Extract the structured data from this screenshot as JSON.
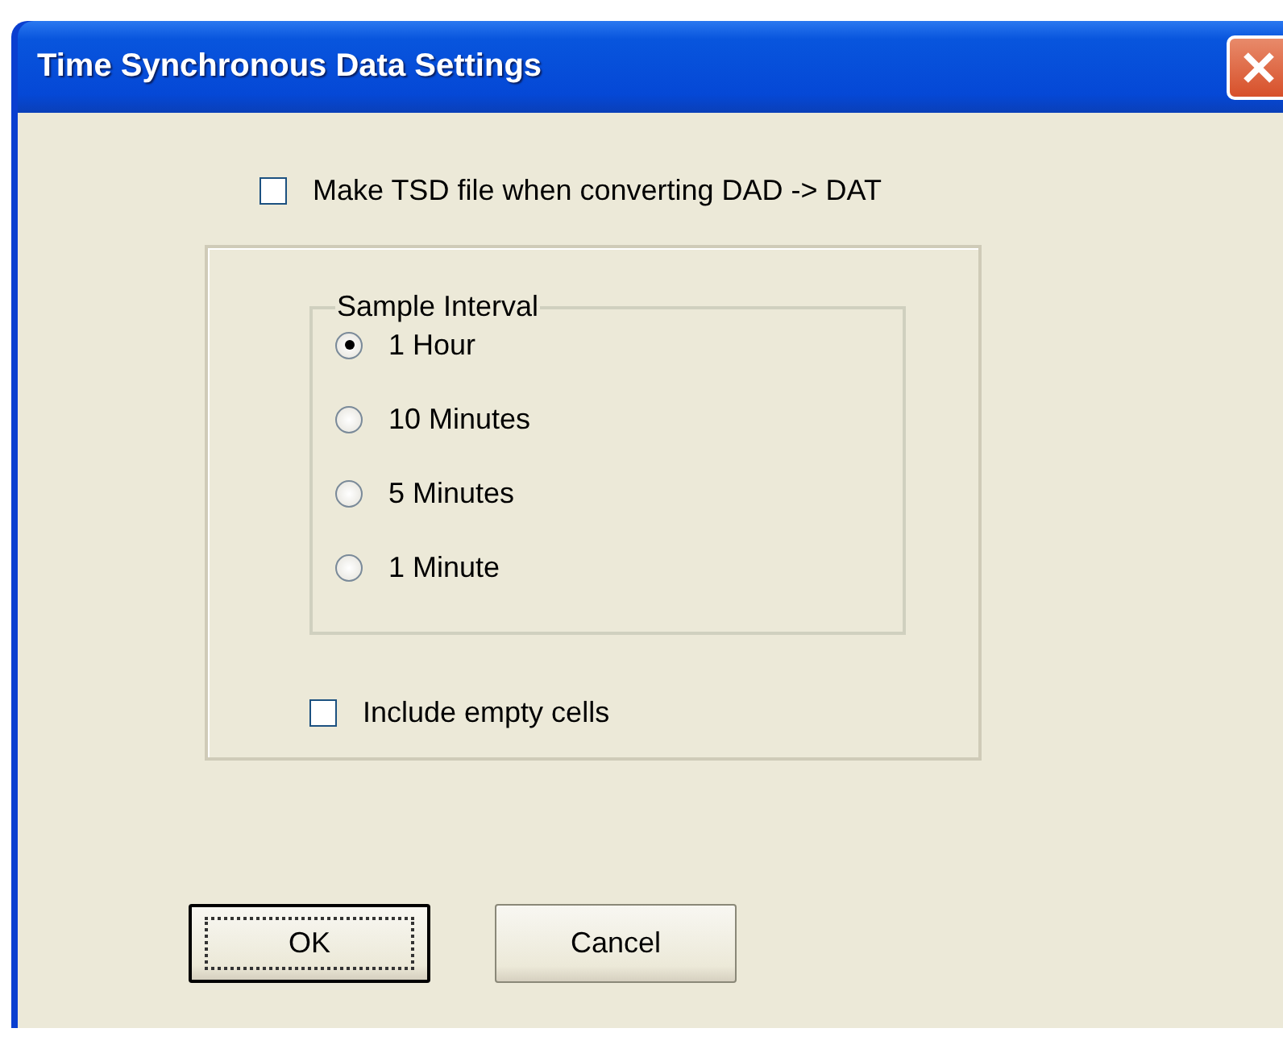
{
  "window": {
    "title": "Time Synchronous Data Settings"
  },
  "make_tsd": {
    "label": "Make TSD file when converting DAD -> DAT",
    "checked": false
  },
  "sample_interval": {
    "legend": "Sample Interval",
    "options": [
      {
        "label": "1 Hour",
        "selected": true
      },
      {
        "label": "10 Minutes",
        "selected": false
      },
      {
        "label": "5 Minutes",
        "selected": false
      },
      {
        "label": "1 Minute",
        "selected": false
      }
    ]
  },
  "include_empty_cells": {
    "label": "Include empty cells",
    "checked": false
  },
  "buttons": [
    {
      "label": "OK",
      "default": true
    },
    {
      "label": "Cancel",
      "default": false
    }
  ]
}
